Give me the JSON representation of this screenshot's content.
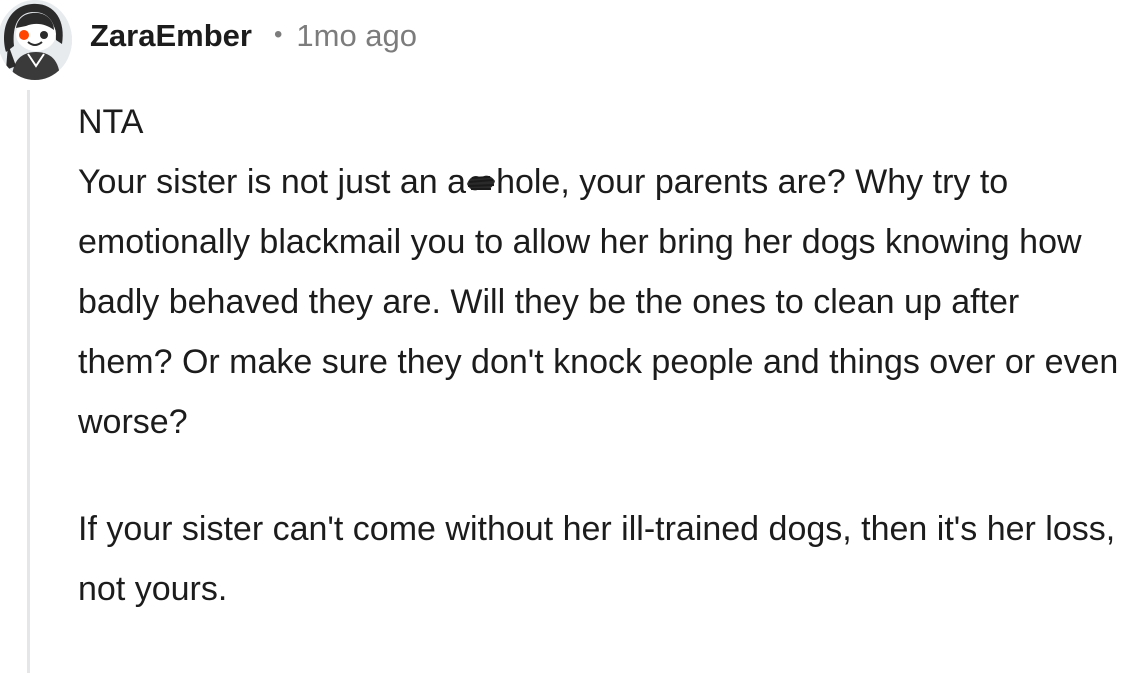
{
  "comment": {
    "author": {
      "username": "ZaraEmber",
      "avatar_icon": "snoo-avatar-icon"
    },
    "separator": "•",
    "timestamp": "1mo ago",
    "body": {
      "line_1": "NTA",
      "para_1_before_redaction": "Your sister is not just an a",
      "para_1_after_redaction": "hole, your parents are? Why try to emotionally blackmail you to allow her bring her dogs knowing how badly behaved they are. Will they be the ones to clean up after them? Or make sure they don't knock people and things over or even worse?",
      "para_2": "If your sister can't come without her ill-trained dogs, then it's her loss, not yours."
    }
  }
}
